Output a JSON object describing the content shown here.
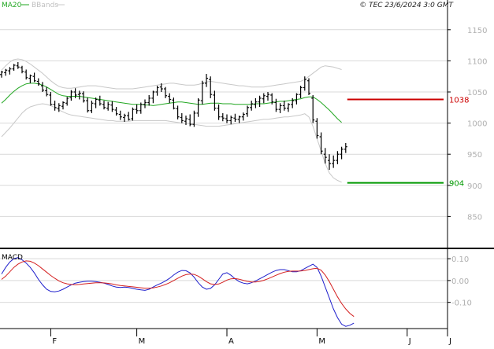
{
  "header": {
    "legend_ma": "MA20",
    "legend_bb": "BBands",
    "copyright": "© TEC 23/6/2024 3:0 GMT"
  },
  "colors": {
    "ma": "#22a722",
    "bb": "#c8c8c8",
    "candle": "#000000",
    "macd": "#1f1fcc",
    "signal": "#d42020",
    "resistance": "#cc0000",
    "support": "#009900",
    "grid": "#d9d9d9",
    "axis_text": "#b0b0b0"
  },
  "chart_data": [
    {
      "type": "line",
      "subtype": "ohlc",
      "ylim": [
        800,
        1175
      ],
      "yticks": [
        850,
        900,
        950,
        1000,
        1050,
        1100,
        1150
      ],
      "x_axis_ticks": [
        {
          "label": "F",
          "index": 12
        },
        {
          "label": "M",
          "index": 33
        },
        {
          "label": "A",
          "index": 55
        },
        {
          "label": "M",
          "index": 77
        },
        {
          "label": "J",
          "index": 99
        },
        {
          "label": "J",
          "index": 121
        }
      ],
      "bars": [
        [
          1078,
          1084,
          1073,
          1082
        ],
        [
          1081,
          1087,
          1076,
          1085
        ],
        [
          1084,
          1090,
          1078,
          1087
        ],
        [
          1087,
          1095,
          1084,
          1093
        ],
        [
          1092,
          1098,
          1087,
          1090
        ],
        [
          1089,
          1092,
          1080,
          1083
        ],
        [
          1082,
          1086,
          1070,
          1073
        ],
        [
          1072,
          1078,
          1064,
          1076
        ],
        [
          1075,
          1081,
          1066,
          1068
        ],
        [
          1067,
          1072,
          1060,
          1063
        ],
        [
          1060,
          1066,
          1050,
          1053
        ],
        [
          1052,
          1058,
          1043,
          1046
        ],
        [
          1045,
          1050,
          1028,
          1030
        ],
        [
          1030,
          1036,
          1020,
          1025
        ],
        [
          1024,
          1032,
          1018,
          1028
        ],
        [
          1027,
          1035,
          1022,
          1033
        ],
        [
          1032,
          1042,
          1028,
          1040
        ],
        [
          1041,
          1053,
          1036,
          1050
        ],
        [
          1050,
          1056,
          1040,
          1045
        ],
        [
          1046,
          1052,
          1038,
          1048
        ],
        [
          1047,
          1051,
          1033,
          1036
        ],
        [
          1036,
          1041,
          1017,
          1020
        ],
        [
          1020,
          1036,
          1016,
          1032
        ],
        [
          1031,
          1041,
          1024,
          1038
        ],
        [
          1037,
          1044,
          1028,
          1031
        ],
        [
          1030,
          1036,
          1022,
          1025
        ],
        [
          1024,
          1034,
          1020,
          1030
        ],
        [
          1029,
          1035,
          1018,
          1022
        ],
        [
          1021,
          1026,
          1012,
          1015
        ],
        [
          1014,
          1020,
          1005,
          1010
        ],
        [
          1009,
          1015,
          1002,
          1012
        ],
        [
          1012,
          1018,
          1004,
          1006
        ],
        [
          1007,
          1025,
          1004,
          1022
        ],
        [
          1022,
          1030,
          1015,
          1020
        ],
        [
          1020,
          1033,
          1015,
          1030
        ],
        [
          1030,
          1038,
          1024,
          1033
        ],
        [
          1033,
          1045,
          1028,
          1040
        ],
        [
          1040,
          1052,
          1032,
          1050
        ],
        [
          1050,
          1060,
          1044,
          1057
        ],
        [
          1058,
          1064,
          1050,
          1055
        ],
        [
          1055,
          1058,
          1040,
          1044
        ],
        [
          1043,
          1048,
          1032,
          1038
        ],
        [
          1037,
          1041,
          1022,
          1024
        ],
        [
          1023,
          1028,
          1006,
          1010
        ],
        [
          1009,
          1016,
          1000,
          1004
        ],
        [
          1003,
          1012,
          997,
          1007
        ],
        [
          1006,
          1014,
          995,
          998
        ],
        [
          998,
          1020,
          994,
          1016
        ],
        [
          1016,
          1040,
          1010,
          1037
        ],
        [
          1036,
          1068,
          1030,
          1064
        ],
        [
          1064,
          1079,
          1058,
          1072
        ],
        [
          1070,
          1075,
          1040,
          1046
        ],
        [
          1045,
          1052,
          1020,
          1024
        ],
        [
          1024,
          1030,
          1005,
          1010
        ],
        [
          1010,
          1016,
          1003,
          1008
        ],
        [
          1007,
          1014,
          1000,
          1004
        ],
        [
          1004,
          1012,
          998,
          1009
        ],
        [
          1008,
          1015,
          1002,
          1006
        ],
        [
          1006,
          1012,
          1000,
          1010
        ],
        [
          1010,
          1017,
          1004,
          1014
        ],
        [
          1015,
          1028,
          1010,
          1025
        ],
        [
          1025,
          1036,
          1020,
          1031
        ],
        [
          1030,
          1040,
          1024,
          1034
        ],
        [
          1034,
          1044,
          1026,
          1040
        ],
        [
          1039,
          1048,
          1032,
          1044
        ],
        [
          1043,
          1050,
          1036,
          1046
        ],
        [
          1045,
          1048,
          1030,
          1034
        ],
        [
          1033,
          1039,
          1018,
          1022
        ],
        [
          1022,
          1032,
          1016,
          1028
        ],
        [
          1028,
          1036,
          1020,
          1024
        ],
        [
          1024,
          1032,
          1018,
          1030
        ],
        [
          1030,
          1040,
          1024,
          1036
        ],
        [
          1036,
          1048,
          1030,
          1046
        ],
        [
          1046,
          1060,
          1040,
          1057
        ],
        [
          1057,
          1075,
          1052,
          1070
        ],
        [
          1068,
          1072,
          1045,
          1048
        ],
        [
          1040,
          1045,
          1000,
          1005
        ],
        [
          1003,
          1008,
          975,
          980
        ],
        [
          978,
          985,
          950,
          955
        ],
        [
          950,
          960,
          935,
          945
        ],
        [
          940,
          950,
          925,
          935
        ],
        [
          935,
          948,
          928,
          940
        ],
        [
          940,
          955,
          934,
          950
        ],
        [
          950,
          962,
          942,
          958
        ],
        [
          958,
          968,
          952,
          962
        ]
      ],
      "ma20": [
        1032,
        1038,
        1045,
        1051,
        1056,
        1060,
        1063,
        1064,
        1064,
        1063,
        1061,
        1058,
        1054,
        1050,
        1046,
        1044,
        1043,
        1043,
        1043,
        1043,
        1042,
        1041,
        1040,
        1039,
        1038,
        1037,
        1036,
        1035,
        1034,
        1033,
        1032,
        1031,
        1030,
        1030,
        1030,
        1029,
        1029,
        1028,
        1029,
        1030,
        1031,
        1032,
        1033,
        1034,
        1034,
        1033,
        1032,
        1031,
        1030,
        1030,
        1031,
        1032,
        1032,
        1032,
        1031,
        1031,
        1031,
        1030,
        1030,
        1030,
        1030,
        1030,
        1031,
        1031,
        1031,
        1032,
        1033,
        1034,
        1035,
        1035,
        1036,
        1037,
        1038,
        1039,
        1041,
        1042,
        1042,
        1038,
        1033,
        1027,
        1021,
        1014,
        1007,
        1001
      ],
      "bb_upper": [
        1085,
        1092,
        1098,
        1102,
        1103,
        1102,
        1099,
        1095,
        1090,
        1085,
        1080,
        1074,
        1068,
        1063,
        1059,
        1057,
        1056,
        1056,
        1057,
        1058,
        1059,
        1060,
        1060,
        1060,
        1059,
        1058,
        1057,
        1056,
        1055,
        1055,
        1055,
        1055,
        1055,
        1056,
        1057,
        1058,
        1059,
        1060,
        1061,
        1062,
        1063,
        1064,
        1064,
        1063,
        1062,
        1061,
        1061,
        1061,
        1062,
        1064,
        1066,
        1067,
        1066,
        1065,
        1064,
        1063,
        1062,
        1061,
        1060,
        1060,
        1059,
        1058,
        1058,
        1058,
        1058,
        1059,
        1060,
        1061,
        1062,
        1063,
        1064,
        1065,
        1066,
        1067,
        1070,
        1075,
        1080,
        1085,
        1090,
        1092,
        1091,
        1090,
        1088,
        1086
      ],
      "bb_lower": [
        978,
        985,
        992,
        1000,
        1008,
        1016,
        1022,
        1026,
        1028,
        1030,
        1031,
        1030,
        1028,
        1025,
        1021,
        1018,
        1015,
        1013,
        1012,
        1011,
        1010,
        1009,
        1008,
        1007,
        1006,
        1005,
        1004,
        1004,
        1003,
        1003,
        1003,
        1003,
        1004,
        1004,
        1004,
        1004,
        1004,
        1004,
        1004,
        1004,
        1004,
        1003,
        1002,
        1001,
        1000,
        1000,
        999,
        998,
        997,
        996,
        995,
        995,
        995,
        995,
        996,
        997,
        998,
        999,
        1000,
        1001,
        1002,
        1003,
        1004,
        1005,
        1006,
        1006,
        1007,
        1008,
        1009,
        1010,
        1010,
        1011,
        1012,
        1013,
        1015,
        1010,
        995,
        975,
        955,
        935,
        920,
        912,
        908,
        905
      ],
      "levels": [
        {
          "label": "1038",
          "value": 1038,
          "color": "#cc0000"
        },
        {
          "label": "904",
          "value": 904,
          "color": "#009900"
        }
      ]
    },
    {
      "type": "line",
      "title": "MACD",
      "ylim": [
        -22,
        14
      ],
      "yticks": [
        10,
        0,
        -10
      ],
      "ytick_labels": [
        "0.10",
        "0.00",
        "-0.10"
      ],
      "series": [
        {
          "values": [
            3.0,
            6.0,
            8.5,
            10.0,
            10.5,
            9.5,
            8.0,
            6.0,
            3.5,
            0.5,
            -2.0,
            -4.0,
            -5.0,
            -5.2,
            -4.8,
            -4.0,
            -3.0,
            -2.0,
            -1.2,
            -0.8,
            -0.5,
            -0.3,
            -0.3,
            -0.5,
            -0.8,
            -1.2,
            -1.8,
            -2.5,
            -3.0,
            -3.2,
            -3.0,
            -3.2,
            -3.6,
            -4.0,
            -4.3,
            -4.5,
            -4.0,
            -3.0,
            -2.0,
            -1.2,
            -0.2,
            1.0,
            2.5,
            3.8,
            4.6,
            4.5,
            3.5,
            1.5,
            -1.0,
            -3.0,
            -4.0,
            -3.6,
            -2.0,
            0.5,
            3.0,
            3.6,
            2.4,
            0.8,
            -0.5,
            -1.2,
            -1.5,
            -1.0,
            -0.2,
            0.8,
            1.8,
            2.8,
            3.8,
            4.6,
            5.0,
            5.0,
            4.5,
            4.0,
            4.0,
            4.5,
            5.5,
            6.5,
            7.5,
            6.0,
            2.0,
            -3.0,
            -8.0,
            -13.0,
            -17.0,
            -20.0,
            -21.0,
            -20.5,
            -19.5
          ]
        },
        {
          "values": [
            0.5,
            2.0,
            4.0,
            6.0,
            7.5,
            8.5,
            9.0,
            8.8,
            8.0,
            6.8,
            5.3,
            3.8,
            2.3,
            1.0,
            -0.2,
            -1.0,
            -1.5,
            -1.8,
            -1.9,
            -1.8,
            -1.6,
            -1.4,
            -1.2,
            -1.0,
            -1.0,
            -1.1,
            -1.3,
            -1.6,
            -2.0,
            -2.3,
            -2.5,
            -2.7,
            -2.9,
            -3.1,
            -3.3,
            -3.5,
            -3.5,
            -3.4,
            -3.0,
            -2.5,
            -1.8,
            -1.0,
            0.0,
            1.0,
            2.0,
            2.7,
            3.0,
            2.8,
            2.0,
            0.8,
            -0.5,
            -1.5,
            -1.8,
            -1.6,
            -0.8,
            0.2,
            0.8,
            0.9,
            0.6,
            0.1,
            -0.4,
            -0.7,
            -0.7,
            -0.4,
            0.1,
            0.8,
            1.6,
            2.4,
            3.2,
            3.8,
            4.2,
            4.3,
            4.3,
            4.4,
            4.6,
            5.0,
            5.4,
            5.6,
            4.7,
            2.5,
            -0.5,
            -4.0,
            -7.5,
            -10.5,
            -13.0,
            -15.0,
            -16.5
          ]
        }
      ]
    }
  ]
}
